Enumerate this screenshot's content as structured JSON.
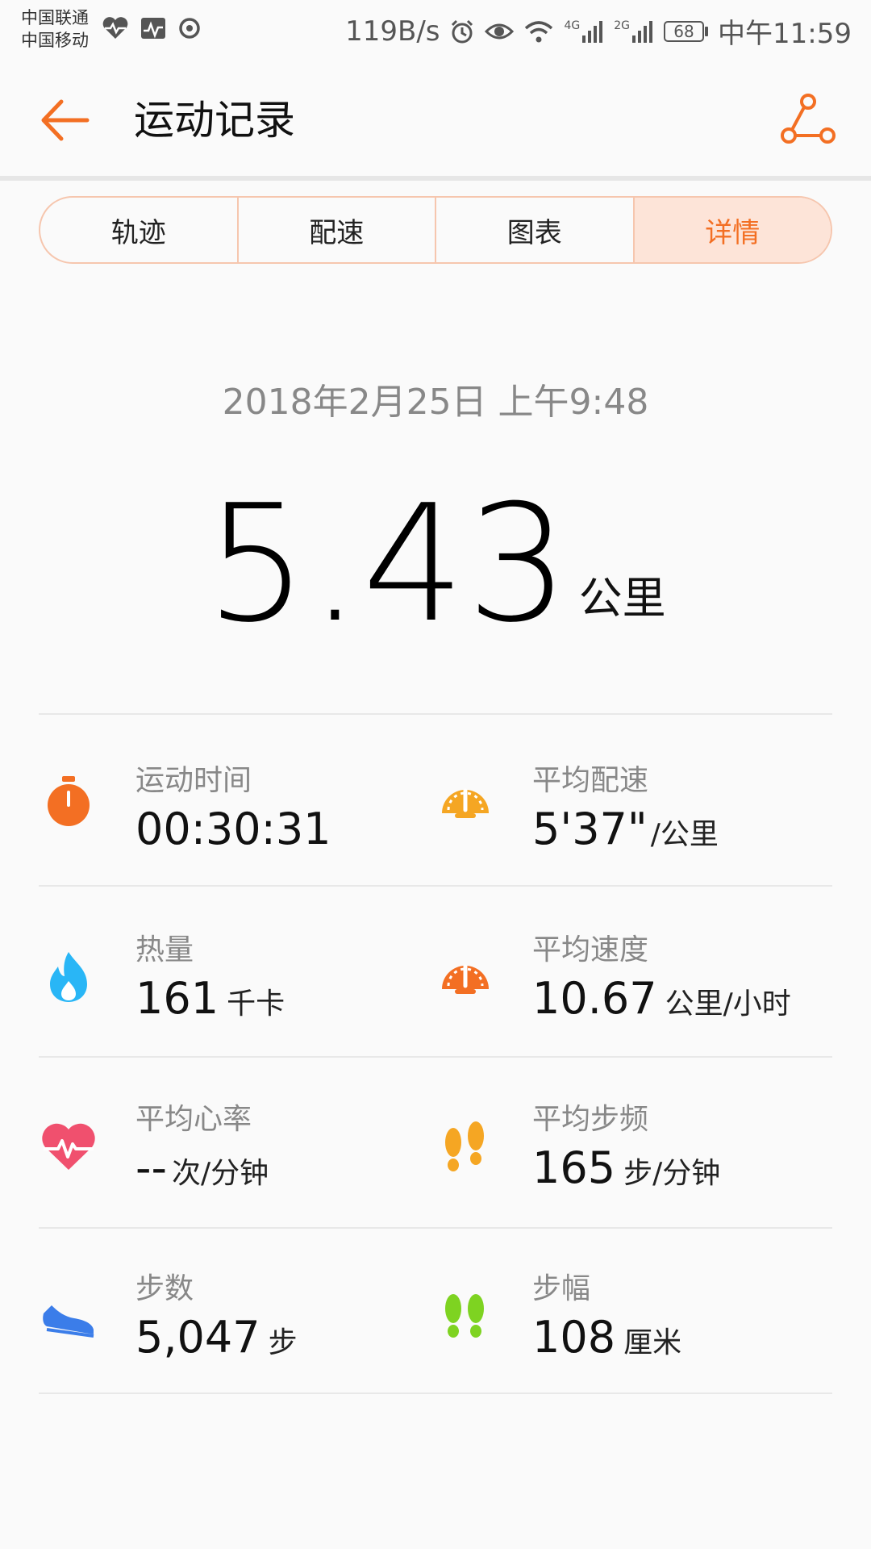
{
  "status_bar": {
    "carrier_1": "中国联通",
    "carrier_2": "中国移动",
    "net_speed": "119B/s",
    "signal_4g": "4G",
    "signal_2g": "2G",
    "battery": "68",
    "time": "中午11:59"
  },
  "header": {
    "title": "运动记录",
    "accent_color": "#f36f23"
  },
  "tabs": [
    {
      "label": "轨迹"
    },
    {
      "label": "配速"
    },
    {
      "label": "图表"
    },
    {
      "label": "详情",
      "active": true
    }
  ],
  "summary": {
    "datetime": "2018年2月25日 上午9:48",
    "distance": "5.43",
    "distance_unit": "公里"
  },
  "stats": [
    {
      "label": "运动时间",
      "value": "00:30:31",
      "unit": "",
      "icon": "stopwatch-icon",
      "color": "#f36f23"
    },
    {
      "label": "平均配速",
      "value": "5'37\"",
      "unit": "/公里",
      "icon": "speedometer-icon",
      "color": "#f5a623"
    },
    {
      "label": "热量",
      "value": "161",
      "unit": "千卡",
      "icon": "flame-icon",
      "color": "#29b6f6"
    },
    {
      "label": "平均速度",
      "value": "10.67",
      "unit": "公里/小时",
      "icon": "speedometer-icon",
      "color": "#f36f23"
    },
    {
      "label": "平均心率",
      "value": "--",
      "unit": "次/分钟",
      "icon": "heart-rate-icon",
      "color": "#f0506e"
    },
    {
      "label": "平均步频",
      "value": "165",
      "unit": "步/分钟",
      "icon": "footprints-icon",
      "color": "#f5a623"
    },
    {
      "label": "步数",
      "value": "5,047",
      "unit": "步",
      "icon": "shoe-icon",
      "color": "#3b7de9"
    },
    {
      "label": "步幅",
      "value": "108",
      "unit": "厘米",
      "icon": "footprints-icon",
      "color": "#7ed321"
    }
  ]
}
